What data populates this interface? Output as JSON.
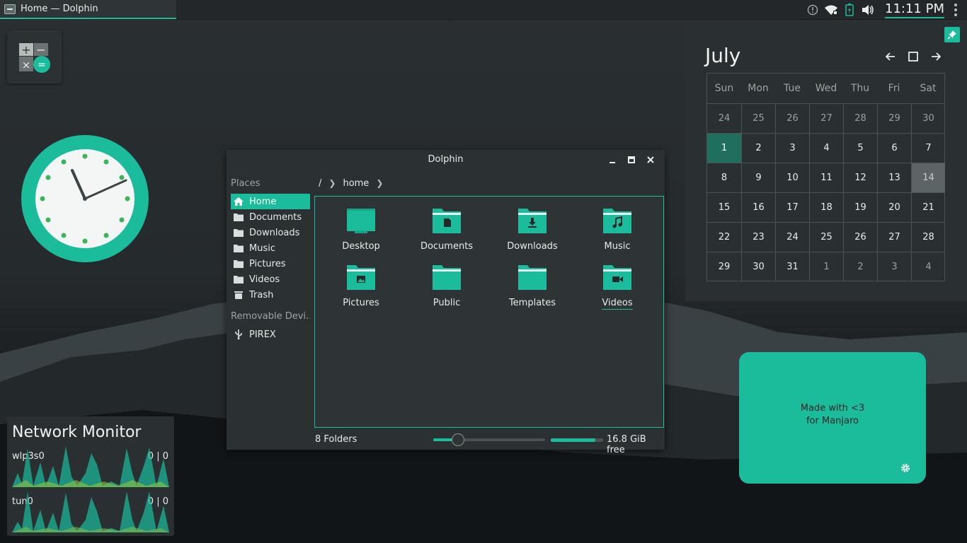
{
  "panel": {
    "task_title": "Home — Dolphin",
    "time": "11:11 PM",
    "tray_icons": [
      "notification-icon",
      "wifi-icon",
      "battery-icon",
      "volume-icon"
    ]
  },
  "dolphin": {
    "title": "Dolphin",
    "places_title": "Places",
    "places": [
      {
        "label": "Home",
        "icon": "home-icon",
        "active": true
      },
      {
        "label": "Documents",
        "icon": "folder-icon"
      },
      {
        "label": "Downloads",
        "icon": "folder-icon"
      },
      {
        "label": "Music",
        "icon": "folder-icon"
      },
      {
        "label": "Pictures",
        "icon": "folder-icon"
      },
      {
        "label": "Videos",
        "icon": "folder-icon"
      },
      {
        "label": "Trash",
        "icon": "trash-icon"
      }
    ],
    "removable_title": "Removable Devi...",
    "removable": [
      {
        "label": "PIREX",
        "icon": "usb-icon"
      }
    ],
    "breadcrumb": {
      "root": "/",
      "current": "home"
    },
    "folders": [
      {
        "label": "Desktop",
        "icon": "desktop-folder-icon"
      },
      {
        "label": "Documents",
        "icon": "documents-folder-icon"
      },
      {
        "label": "Downloads",
        "icon": "downloads-folder-icon"
      },
      {
        "label": "Music",
        "icon": "music-folder-icon"
      },
      {
        "label": "Pictures",
        "icon": "pictures-folder-icon"
      },
      {
        "label": "Public",
        "icon": "public-folder-icon"
      },
      {
        "label": "Templates",
        "icon": "templates-folder-icon"
      },
      {
        "label": "Videos",
        "icon": "videos-folder-icon"
      }
    ],
    "status": "8 Folders",
    "zoom_level": 0.22,
    "free_space_text": "16.8 GiB free",
    "used_fraction": 0.85
  },
  "calendar": {
    "month": "July",
    "weekdays": [
      "Sun",
      "Mon",
      "Tue",
      "Wed",
      "Thu",
      "Fri",
      "Sat"
    ],
    "days": [
      [
        "24",
        "25",
        "26",
        "27",
        "28",
        "29",
        "30"
      ],
      [
        "1",
        "2",
        "3",
        "4",
        "5",
        "6",
        "7"
      ],
      [
        "8",
        "9",
        "10",
        "11",
        "12",
        "13",
        "14"
      ],
      [
        "15",
        "16",
        "17",
        "18",
        "19",
        "20",
        "21"
      ],
      [
        "22",
        "23",
        "24",
        "25",
        "26",
        "27",
        "28"
      ],
      [
        "29",
        "30",
        "31",
        "1",
        "2",
        "3",
        "4"
      ]
    ],
    "today": "1",
    "selected": "14"
  },
  "network_monitor": {
    "title": "Network Monitor",
    "interfaces": [
      {
        "name": "wlp3s0",
        "down": "0",
        "up": "0"
      },
      {
        "name": "tun0",
        "down": "0",
        "up": "0"
      }
    ],
    "separator": "|"
  },
  "note": {
    "text": "Made with <3\nfor Manjaro"
  },
  "colors": {
    "accent": "#1abc9c",
    "panel": "#232729",
    "window": "#2b3032"
  }
}
